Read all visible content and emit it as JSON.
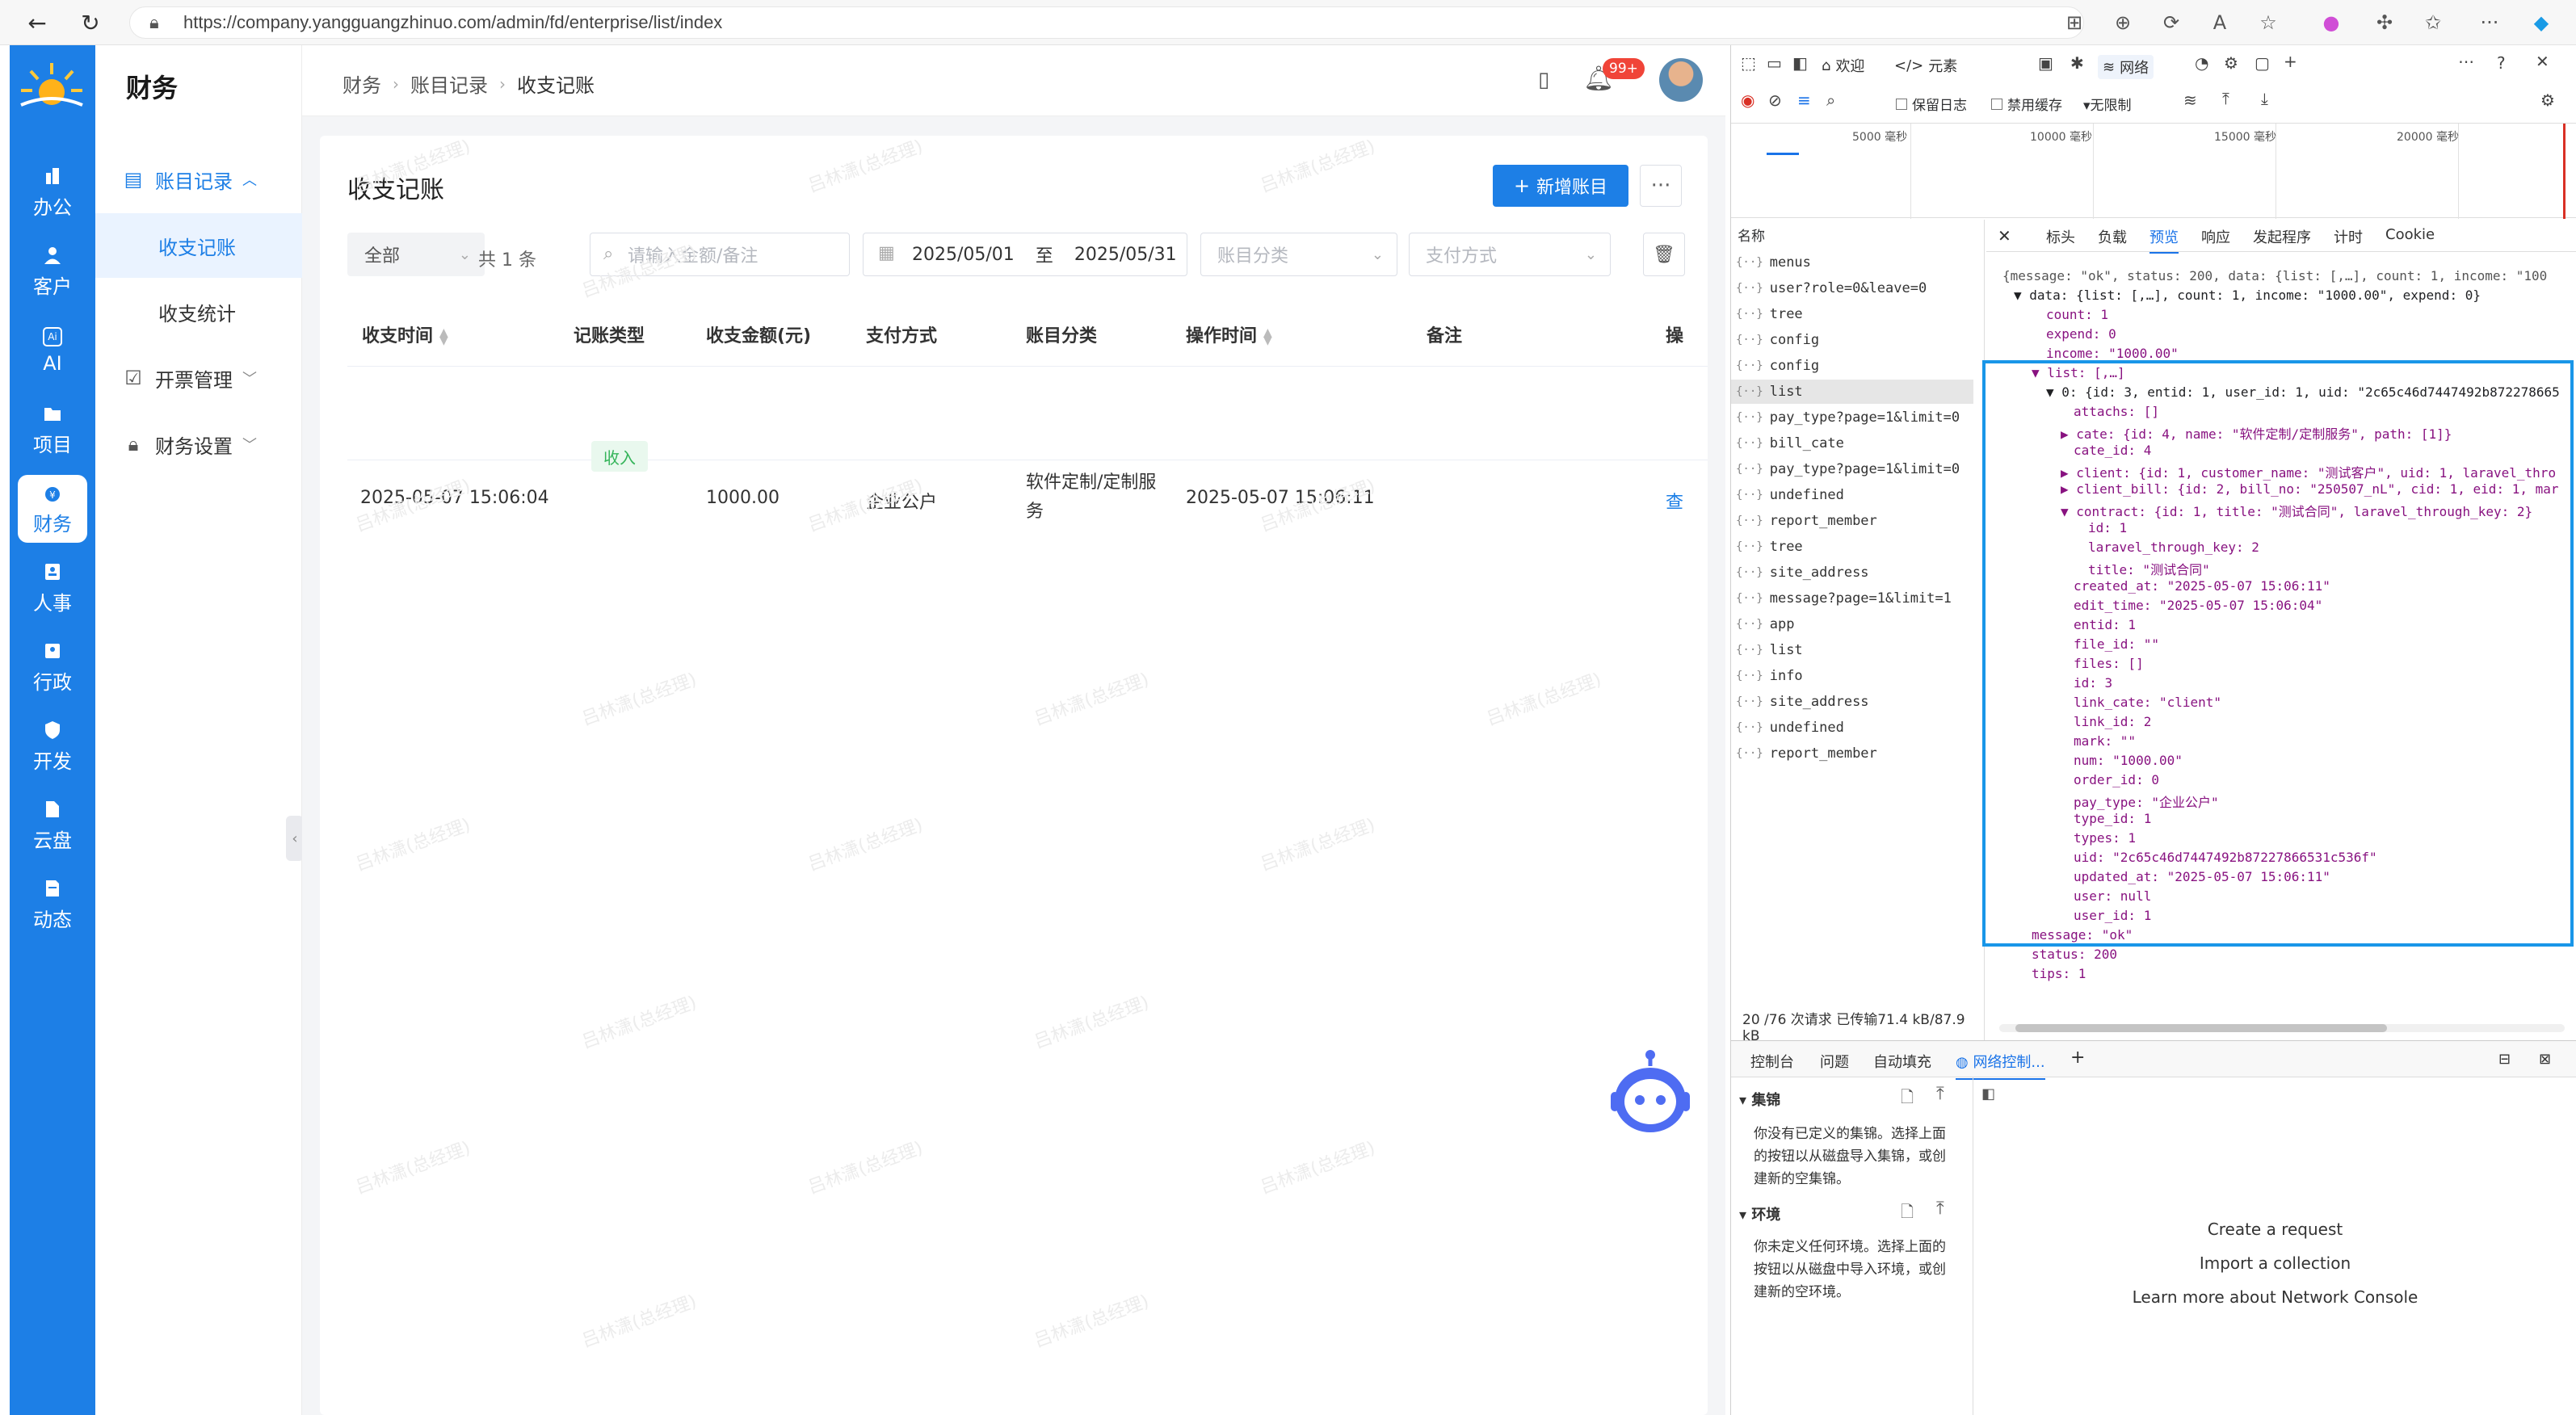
{
  "browser": {
    "url": "https://company.yangguangzhinuo.com/admin/fd/enterprise/list/index"
  },
  "rail": {
    "items": [
      {
        "label": "办公"
      },
      {
        "label": "客户"
      },
      {
        "label": "AI"
      },
      {
        "label": "项目"
      },
      {
        "label": "财务"
      },
      {
        "label": "人事"
      },
      {
        "label": "行政"
      },
      {
        "label": "开发"
      },
      {
        "label": "云盘"
      },
      {
        "label": "动态"
      }
    ],
    "active": "财务",
    "ai_badge": "Ai"
  },
  "subnav": {
    "title": "财务",
    "items": [
      {
        "label": "账目记录"
      },
      {
        "label": "收支记账"
      },
      {
        "label": "收支统计"
      },
      {
        "label": "开票管理"
      },
      {
        "label": "财务设置"
      }
    ]
  },
  "topbar": {
    "breadcrumb": [
      "财务",
      "账目记录",
      "收支记账"
    ],
    "notification_badge": "99+"
  },
  "page": {
    "title": "收支记账",
    "add_button": "新增账目",
    "more_button": "···"
  },
  "filters": {
    "type_value": "全部",
    "count_text": "共 1 条",
    "search_placeholder": "请输入金额/备注",
    "date_start": "2025/05/01",
    "date_to": "至",
    "date_end": "2025/05/31",
    "category_placeholder": "账目分类",
    "pay_placeholder": "支付方式"
  },
  "table": {
    "columns": [
      "收支时间",
      "记账类型",
      "收支金额(元)",
      "支付方式",
      "账目分类",
      "操作时间",
      "备注",
      "操"
    ],
    "rows": [
      {
        "time": "2025-05-07 15:06:04",
        "type": "收入",
        "amount": "1000.00",
        "pay": "企业公户",
        "category_line1": "软件定制/定制服",
        "category_line2": "务",
        "op_time": "2025-05-07 15:06:11",
        "note": "",
        "action": "查"
      }
    ]
  },
  "watermark": "吕林潇(总经理)",
  "devtools": {
    "tabs": [
      "欢迎",
      "元素",
      "网络"
    ],
    "toolbar": {
      "preserve_log": "保留日志",
      "disable_cache": "禁用缓存",
      "throttle": "无限制"
    },
    "timeline_labels": [
      "5000 毫秒",
      "10000 毫秒",
      "15000 毫秒",
      "20000 毫秒"
    ],
    "name_header": "名称",
    "requests": [
      "menus",
      "user?role=0&leave=0",
      "tree",
      "config",
      "config",
      "list",
      "pay_type?page=1&limit=0",
      "bill_cate",
      "pay_type?page=1&limit=0",
      "undefined",
      "report_member",
      "tree",
      "site_address",
      "message?page=1&limit=1",
      "app",
      "list",
      "info",
      "site_address",
      "undefined",
      "report_member"
    ],
    "preview_tabs": [
      "标头",
      "负载",
      "预览",
      "响应",
      "发起程序",
      "计时",
      "Cookie"
    ],
    "status_text": "20 /76 次请求  已传输71.4 kB/87.9 kB",
    "drawer_tabs": [
      "控制台",
      "问题",
      "自动填充",
      "网络控制...",
      "+"
    ],
    "collections_title": "集锦",
    "collections_text": [
      "你没有已定义的集锦。选择上面",
      "的按钮以从磁盘导入集锦，或创",
      "建新的空集锦。"
    ],
    "env_title": "环境",
    "env_text": [
      "你未定义任何环境。选择上面的",
      "按钮以从磁盘中导入环境，或创",
      "建新的空环境。"
    ],
    "nc_links": [
      "Create a request",
      "Import a collection",
      "Learn more about Network Console"
    ],
    "json_lines": [
      "{message: \"ok\", status: 200, data: {list: [,…], count: 1, income: \"100",
      "▼ data: {list: [,…], count: 1, income: \"1000.00\", expend: 0}",
      "count: 1",
      "expend: 0",
      "income: \"1000.00\"",
      "▼ list: [,…]",
      "▼ 0: {id: 3, entid: 1, user_id: 1, uid: \"2c65c46d7447492b872278665",
      "attachs: []",
      "▶ cate: {id: 4, name: \"软件定制/定制服务\", path: [1]}",
      "cate_id: 4",
      "▶ client: {id: 1, customer_name: \"测试客户\", uid: 1, laravel_thro",
      "▶ client_bill: {id: 2, bill_no: \"250507_nL\", cid: 1, eid: 1, mar",
      "▼ contract: {id: 1, title: \"测试合同\", laravel_through_key: 2}",
      "id: 1",
      "laravel_through_key: 2",
      "title: \"测试合同\"",
      "created_at: \"2025-05-07 15:06:11\"",
      "edit_time: \"2025-05-07 15:06:04\"",
      "entid: 1",
      "file_id: \"\"",
      "files: []",
      "id: 3",
      "link_cate: \"client\"",
      "link_id: 2",
      "mark: \"\"",
      "num: \"1000.00\"",
      "order_id: 0",
      "pay_type: \"企业公户\"",
      "type_id: 1",
      "types: 1",
      "uid: \"2c65c46d7447492b87227866531c536f\"",
      "updated_at: \"2025-05-07 15:06:11\"",
      "user: null",
      "user_id: 1",
      "message: \"ok\"",
      "status: 200",
      "tips: 1"
    ]
  }
}
